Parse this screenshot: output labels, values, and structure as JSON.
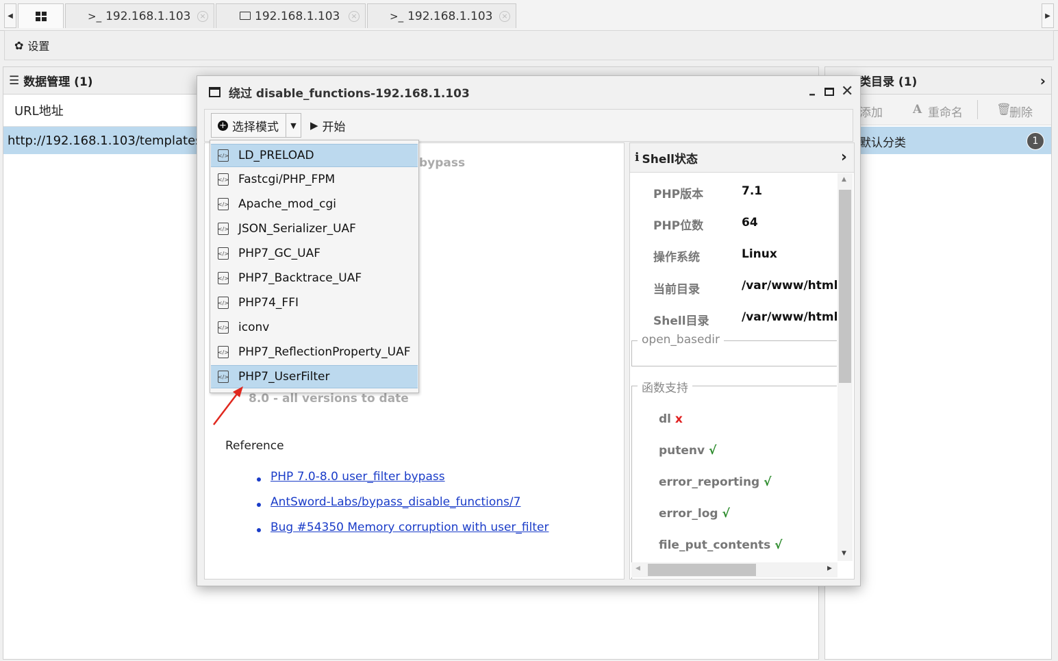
{
  "tabs": {
    "home_icon": "grid-icon",
    "items": [
      {
        "icon": ">_",
        "label": "192.168.1.103"
      },
      {
        "icon": "folder",
        "label": "192.168.1.103"
      },
      {
        "icon": ">_",
        "label": "192.168.1.103"
      }
    ]
  },
  "settings": {
    "label": "设置"
  },
  "data_panel": {
    "title": "数据管理 (1)",
    "column": "URL地址",
    "rows": [
      "http://192.168.1.103/templates/"
    ]
  },
  "category_panel": {
    "title": "类目录 (1)",
    "add_label": "添加",
    "rename_label": "重命名",
    "delete_label": "删除",
    "items": [
      {
        "name": "默认分类",
        "count": "1"
      }
    ]
  },
  "dialog": {
    "title": "绕过 disable_functions-192.168.1.103",
    "select_mode_label": "选择模式",
    "start_label": "开始",
    "mode_options": [
      "LD_PRELOAD",
      "Fastcgi/PHP_FPM",
      "Apache_mod_cgi",
      "JSON_Serializer_UAF",
      "PHP7_GC_UAF",
      "PHP7_Backtrace_UAF",
      "PHP74_FFI",
      "iconv",
      "PHP7_ReflectionProperty_UAF",
      "PHP7_UserFilter"
    ],
    "selected_mode": "PHP7_UserFilter",
    "content": {
      "heading_partial": "bypass",
      "versions": "8.0 - all versions to date",
      "reference_label": "Reference",
      "references": [
        "PHP 7.0-8.0 user_filter bypass",
        "AntSword-Labs/bypass_disable_functions/7",
        "Bug #54350 Memory corruption with user_filter"
      ]
    },
    "shell_status": {
      "title": "Shell状态",
      "fields": [
        {
          "key": "PHP版本",
          "value": "7.1"
        },
        {
          "key": "PHP位数",
          "value": "64"
        },
        {
          "key": "操作系统",
          "value": "Linux"
        },
        {
          "key": "当前目录",
          "value": "/var/www/html"
        },
        {
          "key": "Shell目录",
          "value": "/var/www/html"
        }
      ],
      "open_basedir_label": "open_basedir",
      "functions_label": "函数支持",
      "functions": [
        {
          "name": "dl",
          "mark": "x"
        },
        {
          "name": "putenv",
          "mark": "√"
        },
        {
          "name": "error_reporting",
          "mark": "√"
        },
        {
          "name": "error_log",
          "mark": "√"
        },
        {
          "name": "file_put_contents",
          "mark": "√"
        }
      ]
    }
  },
  "colors": {
    "selection": "#bcd9ee",
    "link": "#1a3cc8",
    "ok": "#2a8a2a",
    "bad": "#e02020",
    "annotation_arrow": "#e0281e"
  }
}
